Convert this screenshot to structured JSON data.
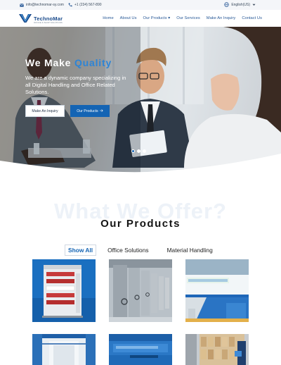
{
  "topbar": {
    "email": "info@technomar-sy.com",
    "phone": "+1 (234) 567-890",
    "language": "English(US)",
    "icons": {
      "email": "mail-icon",
      "phone": "phone-icon",
      "language": "globe-icon",
      "dropdown": "chevron-down-icon"
    }
  },
  "header": {
    "brand": "TechnoMar",
    "tagline": "OFFICE & SHOP SOLUTIONS",
    "nav": [
      {
        "label": "Home"
      },
      {
        "label": "About Us"
      },
      {
        "label": "Our Products"
      },
      {
        "label": "Our Services"
      },
      {
        "label": "Make An Inquiry"
      },
      {
        "label": "Contact Us"
      }
    ]
  },
  "hero": {
    "title_prefix": "We Make",
    "title_accent": "Quality",
    "text": "We are a dynamic company specializing in all Digital Handling and Office Related Solutions.",
    "btn_inquiry": "Make An Inquiry",
    "btn_products": "Our Products",
    "slides_total": 3,
    "active_slide": 1
  },
  "products": {
    "watermark": "What We Offer?",
    "title": "Our Products",
    "tabs": [
      {
        "label": "Show All"
      },
      {
        "label": "Office Solutions"
      },
      {
        "label": "Material Handling"
      }
    ],
    "active_tab": "Show All"
  },
  "colors": {
    "brand_blue": "#1464b4",
    "accent_blue": "#2d84d6",
    "nav_text": "#2b5b98",
    "topbar_bg": "#f4f6f9"
  }
}
